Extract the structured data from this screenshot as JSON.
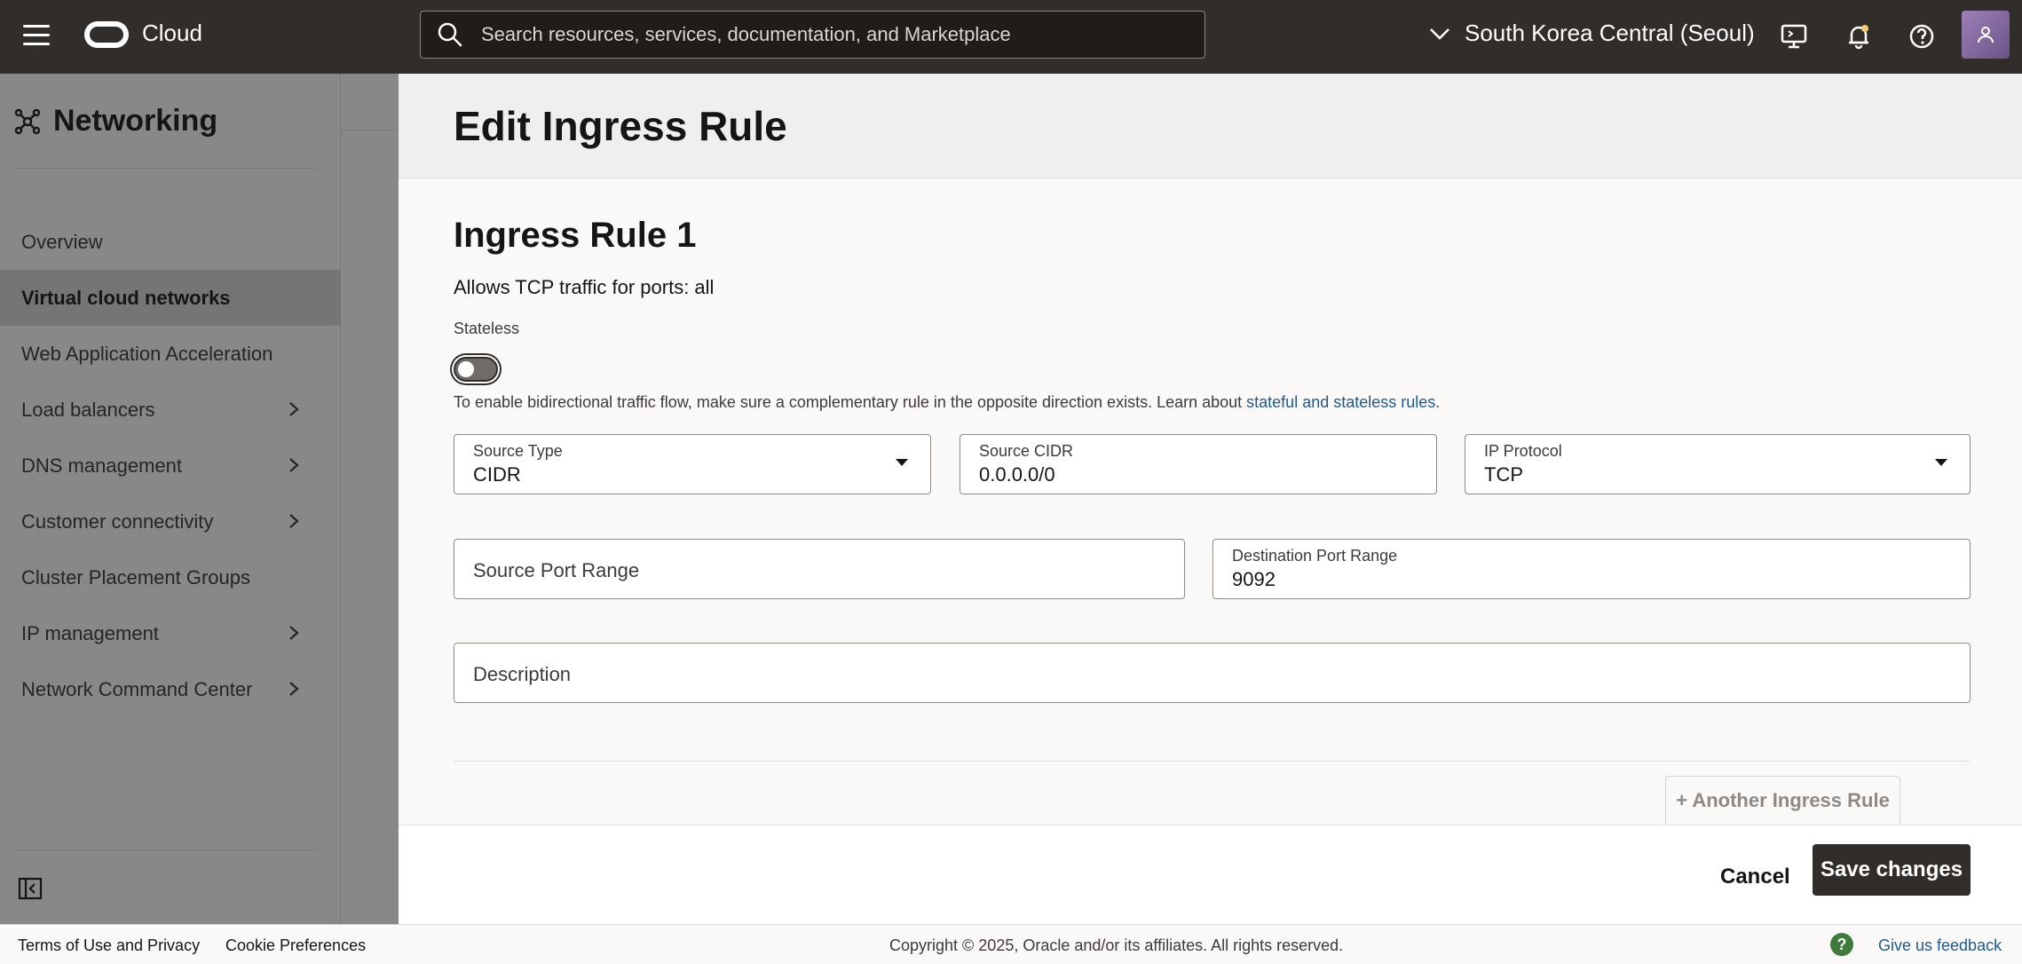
{
  "topbar": {
    "brand": "Cloud",
    "search_placeholder": "Search resources, services, documentation, and Marketplace",
    "region": "South Korea Central (Seoul)"
  },
  "sidebar": {
    "title": "Networking",
    "items": [
      {
        "label": "Overview"
      },
      {
        "label": "Virtual cloud networks"
      },
      {
        "label": "Web Application Acceleration"
      },
      {
        "label": "Load balancers"
      },
      {
        "label": "DNS management"
      },
      {
        "label": "Customer connectivity"
      },
      {
        "label": "Cluster Placement Groups"
      },
      {
        "label": "IP management"
      },
      {
        "label": "Network Command Center"
      }
    ]
  },
  "panel": {
    "title": "Edit Ingress Rule",
    "rule_title": "Ingress Rule 1",
    "rule_desc": "Allows TCP traffic for ports: all",
    "stateless_label": "Stateless",
    "hint_text": "To enable bidirectional traffic flow, make sure a complementary rule in the opposite direction exists. Learn about ",
    "hint_link": "stateful and stateless rules",
    "hint_end": ".",
    "source_type": {
      "label": "Source Type",
      "value": "CIDR"
    },
    "source_cidr": {
      "label": "Source CIDR",
      "value": "0.0.0.0/0"
    },
    "ip_protocol": {
      "label": "IP Protocol",
      "value": "TCP"
    },
    "source_port": {
      "placeholder": "Source Port Range"
    },
    "dest_port": {
      "label": "Destination Port Range",
      "value": "9092"
    },
    "description": {
      "placeholder": "Description"
    },
    "another_rule": "+ Another Ingress Rule",
    "cancel": "Cancel",
    "save": "Save changes"
  },
  "footer": {
    "terms": "Terms of Use and Privacy",
    "cookie": "Cookie Preferences",
    "copyright": "Copyright © 2025, Oracle and/or its affiliates. All rights reserved.",
    "help": "?",
    "feedback": "Give us feedback"
  }
}
